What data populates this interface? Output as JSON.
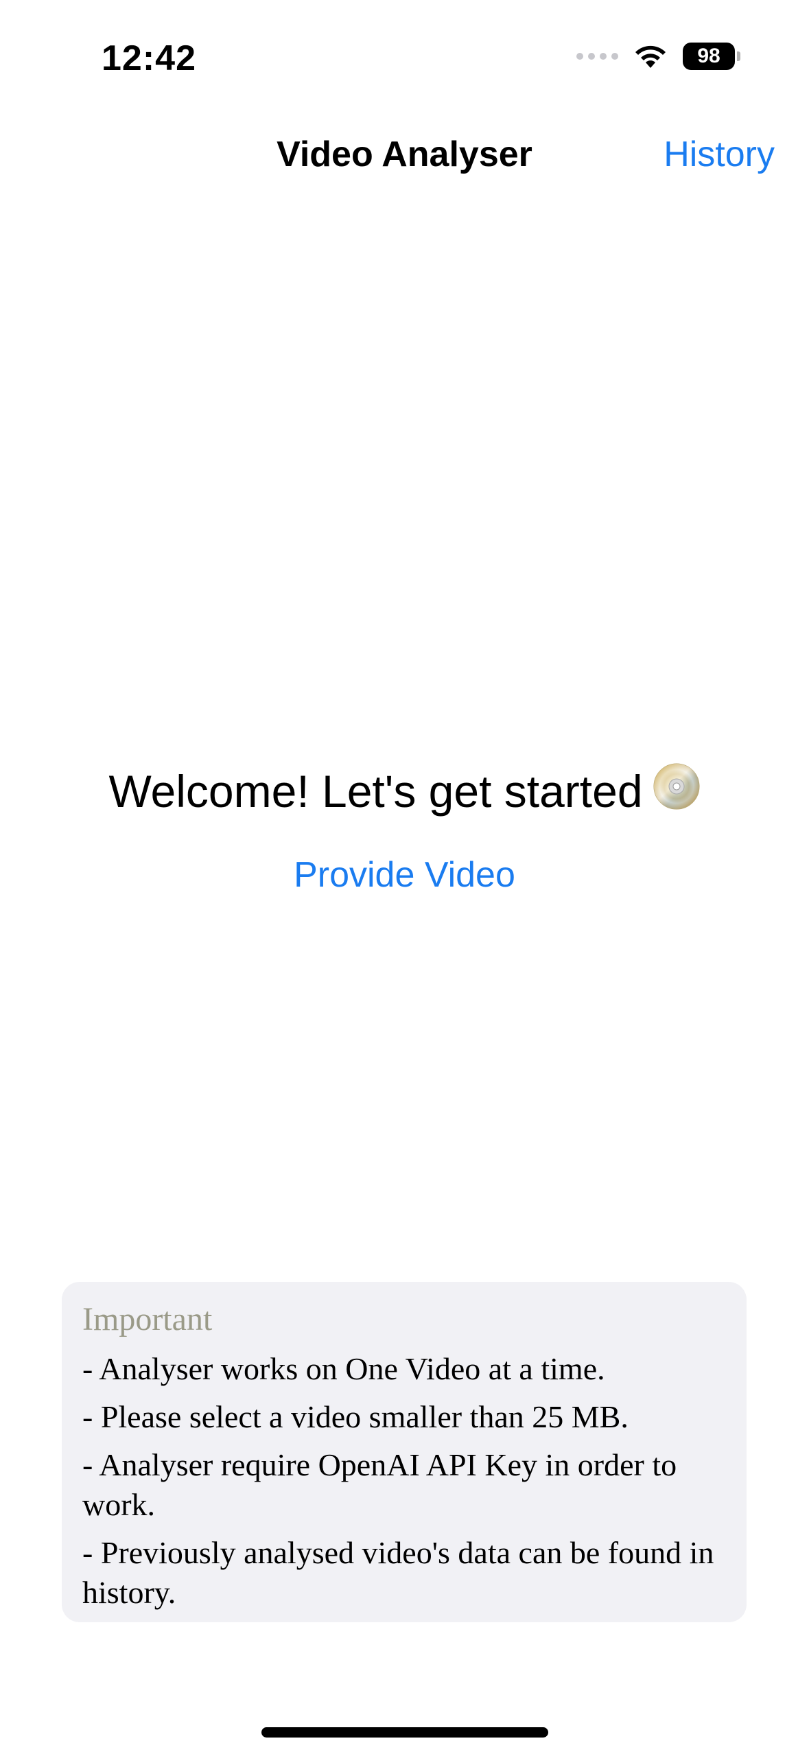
{
  "status_bar": {
    "time": "12:42",
    "battery": "98",
    "signal_icon": "cellular-signal-icon",
    "wifi_icon": "wifi-icon"
  },
  "nav": {
    "title": "Video Analyser",
    "history_label": "History"
  },
  "main": {
    "welcome_text": "Welcome! Let's get started",
    "welcome_icon": "dvd-disc-icon",
    "provide_video_label": "Provide Video"
  },
  "info": {
    "heading": "Important",
    "lines": [
      "- Analyser works on One Video at a time.",
      "- Please select a video smaller than 25 MB.",
      "- Analyser require OpenAI API Key in order to work.",
      "- Previously analysed video's data can be found in history."
    ]
  },
  "colors": {
    "accent": "#1a7cf0",
    "card_background": "#f1f1f5",
    "heading_muted": "#9a9a88"
  }
}
